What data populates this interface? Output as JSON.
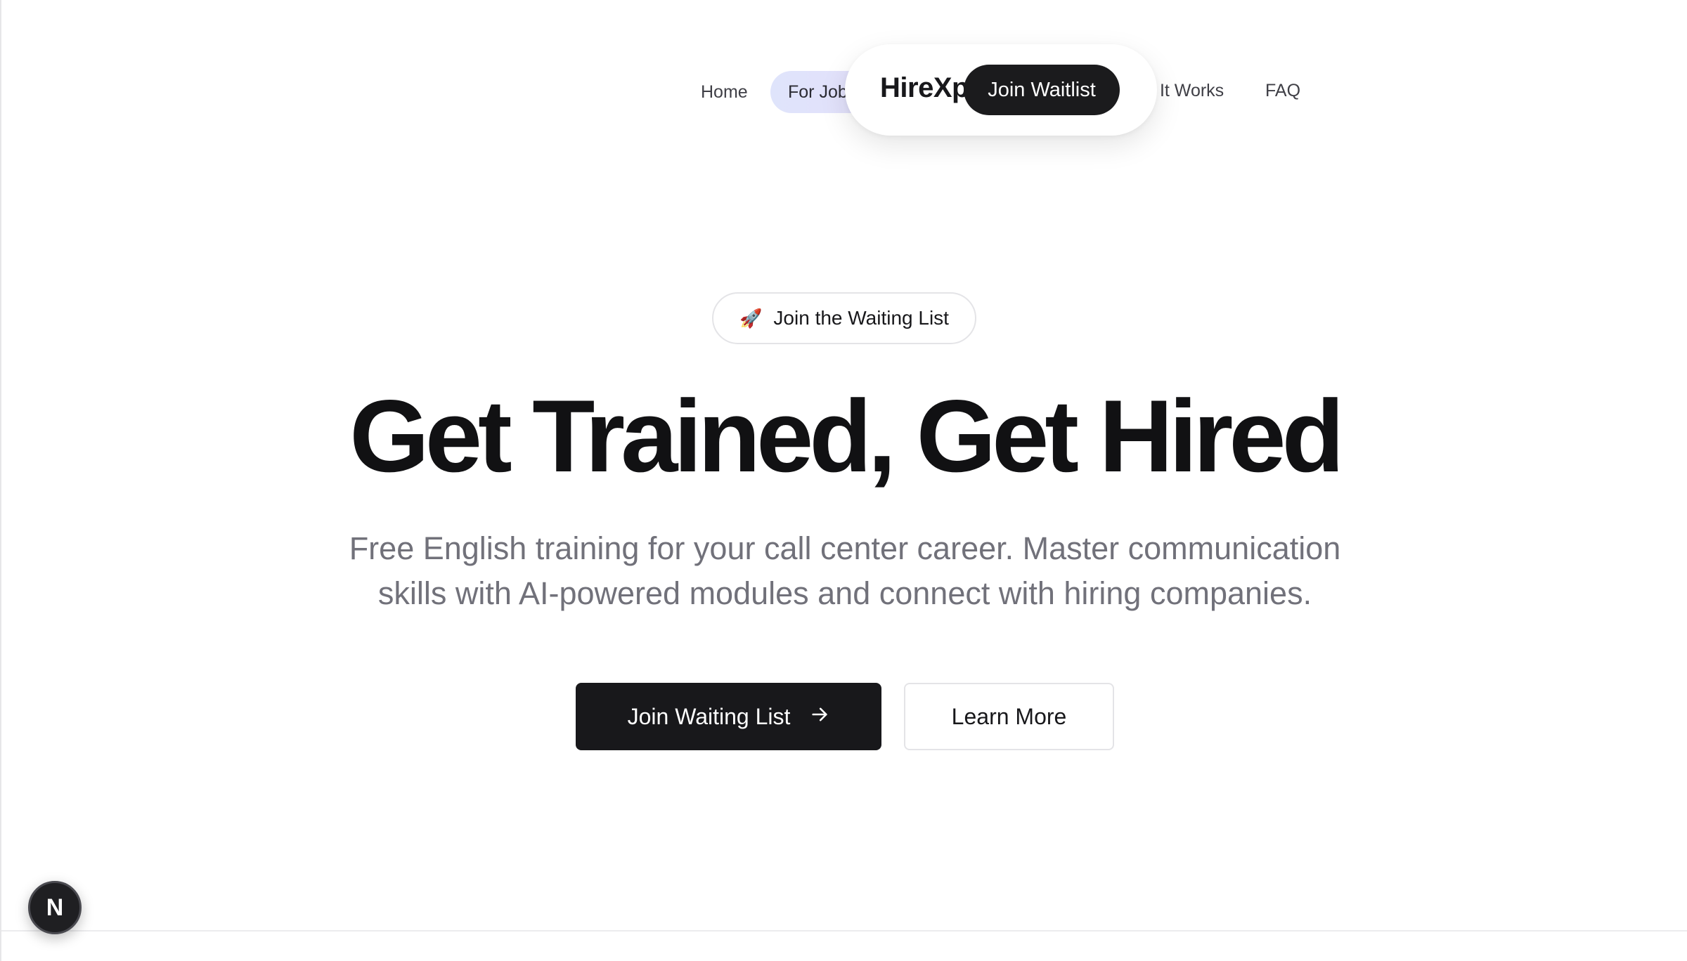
{
  "nav": {
    "home": "Home",
    "job_seekers": "For Job Seekers",
    "how_it_works": "How It Works",
    "faq": "FAQ"
  },
  "brand": {
    "logo_text": "HireXp",
    "cta_label": "Join Waitlist"
  },
  "hero": {
    "badge_icon": "rocket-icon",
    "badge_emoji": "🚀",
    "badge_label": "Join the Waiting List",
    "headline": "Get Trained, Get Hired",
    "subline_1": "Free English training for your call center career. Master communication",
    "subline_2": "skills with AI-powered modules and connect with hiring companies.",
    "primary_button": "Join Waiting List",
    "primary_button_icon": "arrow-right-icon",
    "secondary_button": "Learn More"
  },
  "dev_indicator": {
    "letter": "N",
    "icon": "nextjs-icon"
  },
  "colors": {
    "primary": "#18181b",
    "muted_text": "#71717a",
    "nav_active_bg": "#e2e2fb"
  }
}
